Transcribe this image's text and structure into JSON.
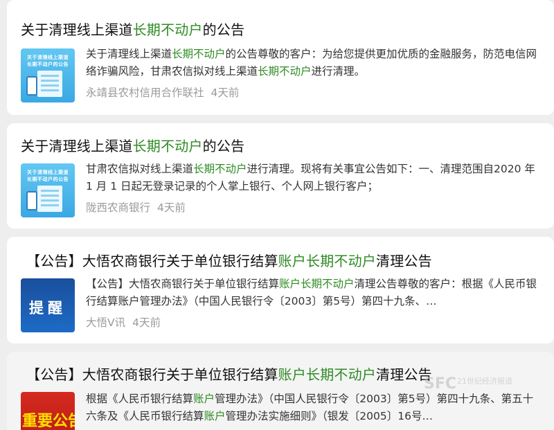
{
  "results": [
    {
      "title_pre": "关于清理线上渠道",
      "title_hl": "长期不动户",
      "title_post": "的公告",
      "snippet_pre": "关于清理线上渠道",
      "snippet_hl1": "长期不动户",
      "snippet_mid": "的公告尊敬的客户：为给您提供更加优质的金融服务，防范电信网络诈骗风险，甘肃农信拟对线上渠道",
      "snippet_hl2": "长期不动户",
      "snippet_post": "进行清理。",
      "source": "永靖县农村信用合作联社",
      "time": "4天前",
      "thumb": {
        "line1": "关于清理线上渠道",
        "line2": "长期不动户的公告"
      }
    },
    {
      "title_pre": "关于清理线上渠道",
      "title_hl": "长期不动户",
      "title_post": "的公告",
      "snippet_pre": "甘肃农信拟对线上渠道",
      "snippet_hl1": "长期不动户",
      "snippet_mid": "进行清理。现将有关事宜公告如下：一、清理范围自2020 年 1 月 1 日起无登录记录的个人掌上银行、个人网上银行客户；",
      "snippet_hl2": "",
      "snippet_post": "",
      "source": "陇西农商银行",
      "time": "4天前",
      "thumb": {
        "line1": "关于清理线上渠道",
        "line2": "长期不动户的公告"
      }
    },
    {
      "title_pre": "【公告】大悟农商银行关于单位银行结算",
      "title_hl": "账户长期不动户",
      "title_post": "清理公告",
      "snippet_pre": "【公告】大悟农商银行关于单位银行结算",
      "snippet_hl1": "账户长期不动户",
      "snippet_mid": "清理公告尊敬的客户：根据《人民币银行结算账户管理办法》（中国人民银行令〔2003〕第5号）第四十九条、…",
      "snippet_hl2": "",
      "snippet_post": "",
      "source": "大悟V讯",
      "time": "4天前",
      "thumb": {
        "text": "提醒"
      }
    },
    {
      "title_pre": "【公告】大悟农商银行关于单位银行结算",
      "title_hl": "账户长期不动户",
      "title_post": "清理公告",
      "snippet_pre": "根据《人民币银行结算",
      "snippet_hl1": "账户",
      "snippet_mid": "管理办法》（中国人民银行令〔2003〕第5号）第四十九条、第五十六条及《人民币银行结算",
      "snippet_hl2": "账户",
      "snippet_post": "管理办法实施细则》（银发〔2005〕16号…",
      "source": "",
      "time": "",
      "thumb": {
        "text": "重要公告"
      }
    }
  ],
  "watermark": {
    "logo": "SFC",
    "line1": "21世纪经济报道",
    "line2": ""
  },
  "colors": {
    "highlight": "#2e8b23",
    "background": "#eeeeee",
    "card": "#ffffff",
    "meta": "#9a9a9a"
  }
}
